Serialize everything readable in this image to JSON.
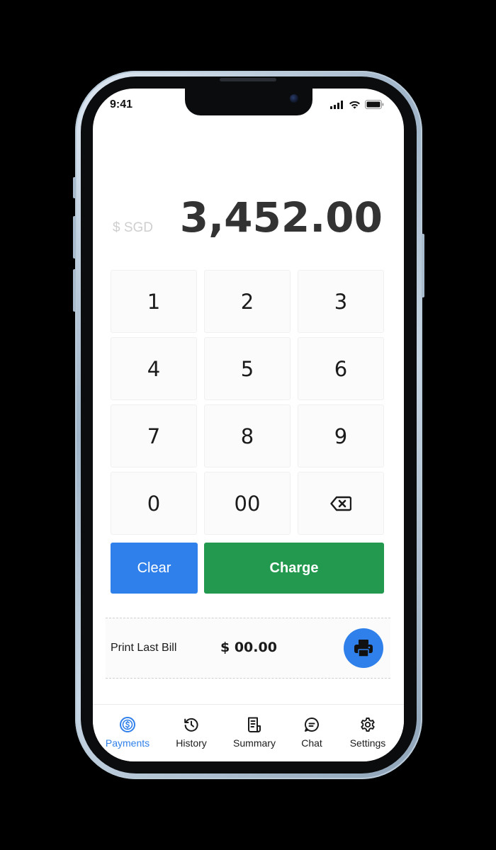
{
  "status_bar": {
    "time": "9:41"
  },
  "display": {
    "currency": "$ SGD",
    "amount": "3,452.00"
  },
  "keypad": {
    "keys": [
      "1",
      "2",
      "3",
      "4",
      "5",
      "6",
      "7",
      "8",
      "9",
      "0",
      "00"
    ],
    "backspace_icon": "backspace-icon"
  },
  "actions": {
    "clear_label": "Clear",
    "charge_label": "Charge"
  },
  "print": {
    "label": "Print Last Bill",
    "amount": "$ 00.00",
    "icon": "printer-icon"
  },
  "nav": {
    "items": [
      {
        "label": "Payments",
        "icon": "dollar-circle-icon",
        "active": true
      },
      {
        "label": "History",
        "icon": "history-icon",
        "active": false
      },
      {
        "label": "Summary",
        "icon": "receipt-icon",
        "active": false
      },
      {
        "label": "Chat",
        "icon": "chat-icon",
        "active": false
      },
      {
        "label": "Settings",
        "icon": "gear-icon",
        "active": false
      }
    ]
  },
  "colors": {
    "accent_blue": "#2f80ea",
    "charge_green": "#22994f",
    "amount_text": "#333333",
    "currency_text": "#cfcfcf"
  }
}
